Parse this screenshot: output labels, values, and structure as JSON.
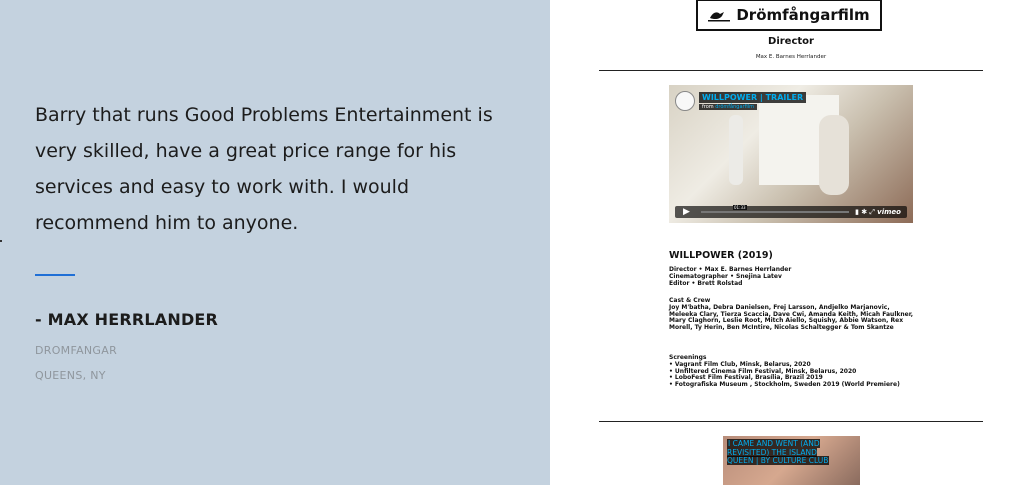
{
  "testimonial": {
    "quote": "Barry that runs Good Problems Entertainment is very skilled, have a great price range for his services and easy to work with. I would recommend him to anyone.",
    "author": "- MAX HERRLANDER",
    "company": "DROMFANGAR",
    "location": "QUEENS, NY"
  },
  "preview": {
    "logo_text": "Drömfångarfilm",
    "role": "Director",
    "role_name": "Max E. Barnes Herrlander",
    "video": {
      "title": "WILLPOWER | TRAILER",
      "from_label": "from",
      "from_user": "drömfångarfilm",
      "time": "01:33",
      "brand": "vimeo"
    },
    "film_title": "WILLPOWER (2019)",
    "credits": [
      "Director • Max E. Barnes Herrlander",
      "Cinematographer • Snejina Latev",
      "Editor • Brett Rolstad"
    ],
    "cast_heading": "Cast & Crew",
    "cast_text": "Joy M'batha, Debra Danielsen, Frej Larsson, Andjelko Marjanovic, Meleeka Clary, Tierza Scaccia, Dave Cwi, Amanda Keith, Micah Faulkner, Mary Claghorn, Leslie Root, Mitch Aiello, Squishy, Abbie Watson, Rex Morell, Ty Herin, Ben McIntire, Nicolas Schaltegger & Tom Skantze",
    "screenings_heading": "Screenings",
    "screenings": [
      "• Vagrant Film Club, Minsk, Belarus, 2020",
      "• Unfiltered Cinema Film Festival, Minsk, Belarus, 2020",
      "• LoboFest Film Festival, Brasília, Brazil 2019",
      "• Fotografiska Museum , Stockholm, Sweden 2019 (World Premiere)"
    ],
    "next_video_title": "I CAME AND WENT (AND REVISITED) THE ISLAND QUEEN | BY CULTURE CLUB"
  },
  "colors": {
    "left_bg": "#c4d2df",
    "accent": "#1f6fd6",
    "vimeo_blue": "#00adef"
  },
  "icons": [
    "bird-logo-icon",
    "play-icon",
    "volume-icon",
    "settings-icon",
    "fullscreen-icon"
  ]
}
